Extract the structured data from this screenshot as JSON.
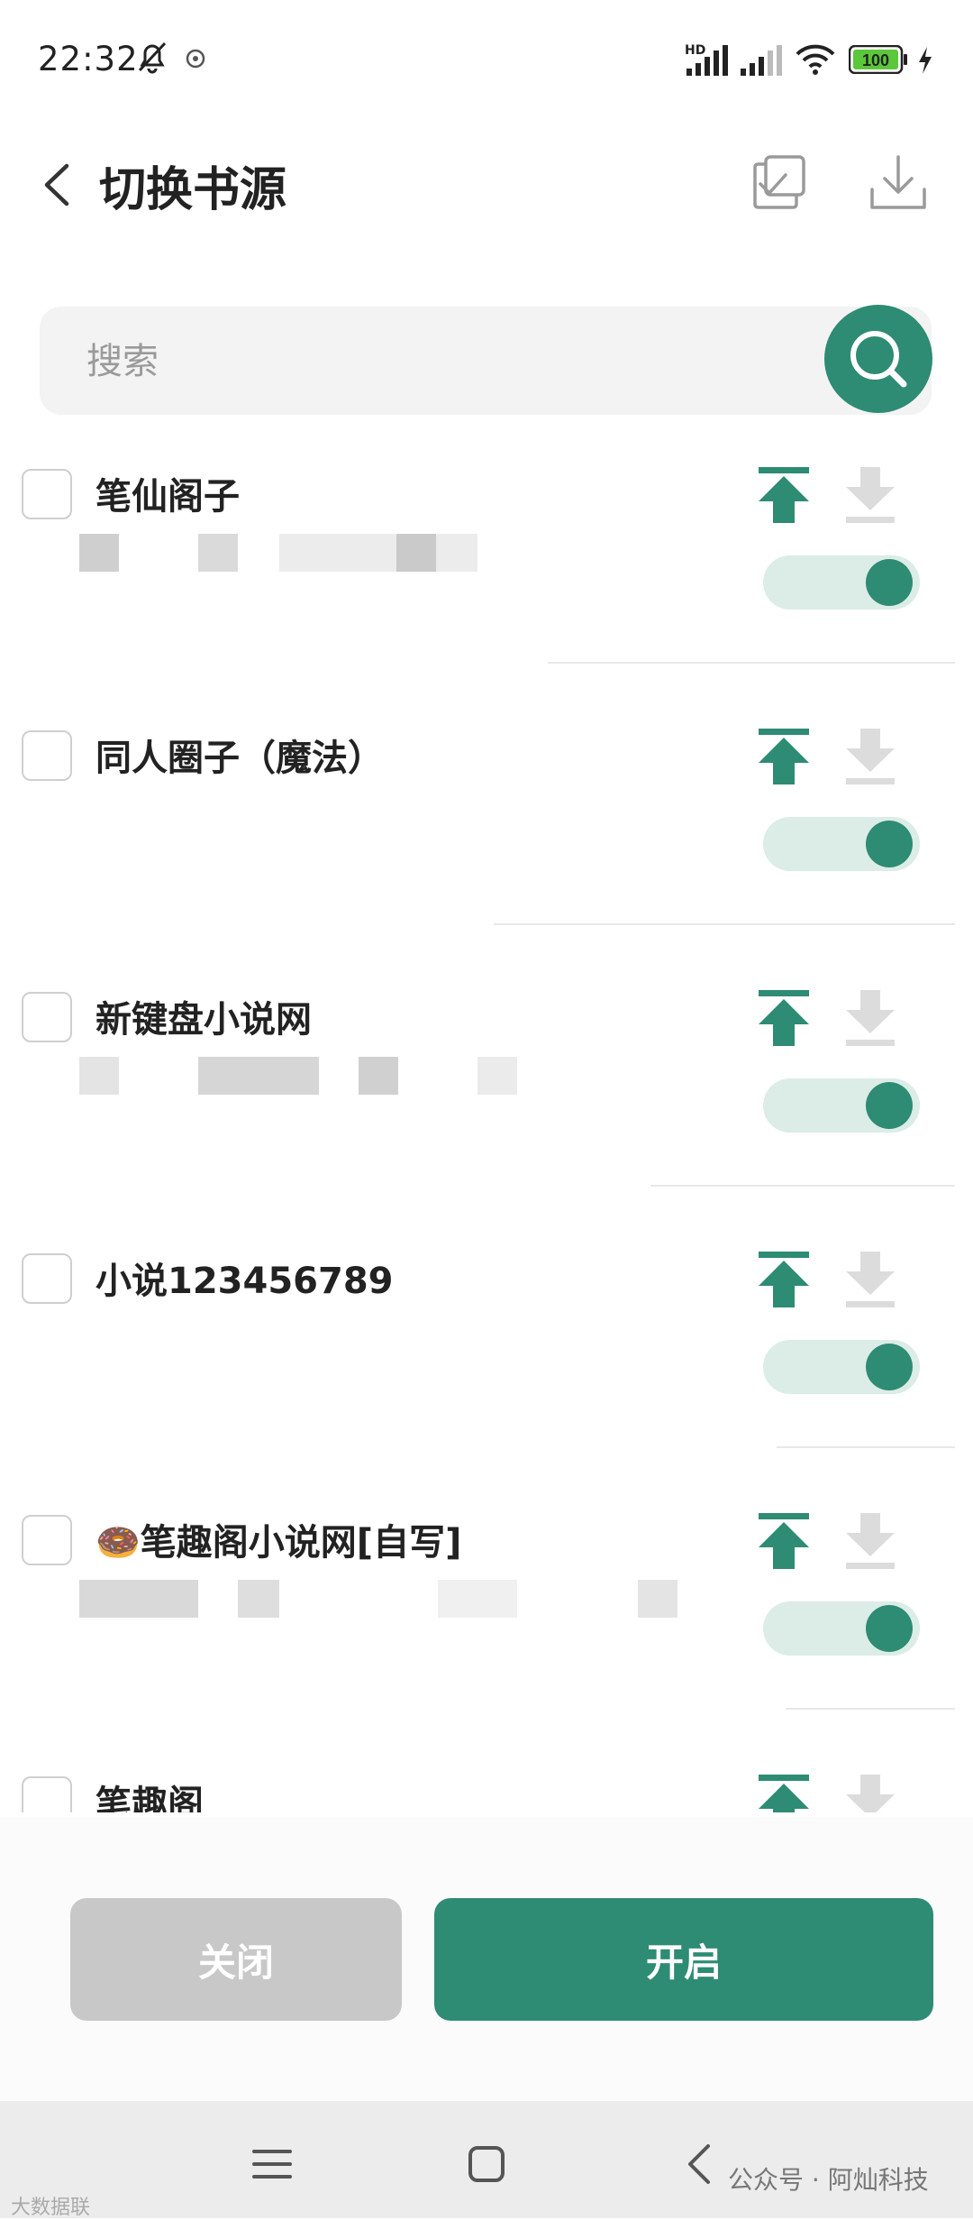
{
  "status_bar": {
    "time": "22:32",
    "network_label": "HD",
    "battery": "100"
  },
  "header": {
    "title": "切换书源"
  },
  "search": {
    "placeholder": "搜索"
  },
  "sources": [
    {
      "name": "笔仙阁子",
      "enabled": true,
      "checked": false
    },
    {
      "name": "同人圈子（魔法）",
      "enabled": true,
      "checked": false
    },
    {
      "name": "新键盘小说网",
      "enabled": true,
      "checked": false
    },
    {
      "name": "小说123456789",
      "enabled": true,
      "checked": false
    },
    {
      "name": "🍩笔趣阁小说网[自写]",
      "enabled": true,
      "checked": false
    },
    {
      "name": "笔趣阁",
      "enabled": true,
      "checked": false
    }
  ],
  "footer": {
    "close_label": "关闭",
    "open_label": "开启"
  },
  "watermark": {
    "text": "公众号 · 阿灿科技",
    "corner_text": "大数据联"
  },
  "colors": {
    "accent": "#2e8b74",
    "toggle_track": "#dcece7",
    "disabled": "#c8c8c8"
  }
}
